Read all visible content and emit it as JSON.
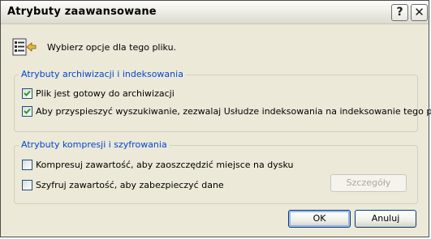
{
  "window": {
    "title": "Atrybuty zaawansowane",
    "help_label": "?",
    "close_label": "✕"
  },
  "prompt": "Wybierz opcje dla tego pliku.",
  "archive_group": {
    "legend": "Atrybuty archiwizacji i indeksowania",
    "options": [
      {
        "label": "Plik jest gotowy do archiwizacji",
        "checked": true
      },
      {
        "label": "Aby przyspieszyć wyszukiwanie, zezwalaj Usłudze indeksowania na indeksowanie tego pliku",
        "checked": true
      }
    ]
  },
  "compress_group": {
    "legend": "Atrybuty kompresji i szyfrowania",
    "options": [
      {
        "label": "Kompresuj zawartość, aby zaoszczędzić miejsce na dysku",
        "checked": false
      },
      {
        "label": "Szyfruj zawartość, aby zabezpieczyć dane",
        "checked": false
      }
    ],
    "details_label": "Szczegóły"
  },
  "buttons": {
    "ok": "OK",
    "cancel": "Anuluj"
  },
  "colors": {
    "dialog_bg": "#ece9d8",
    "legend_text": "#0046d5",
    "checkmark": "#21a121"
  },
  "icons": {
    "header": "file-properties-icon",
    "check": "checkmark-icon"
  }
}
